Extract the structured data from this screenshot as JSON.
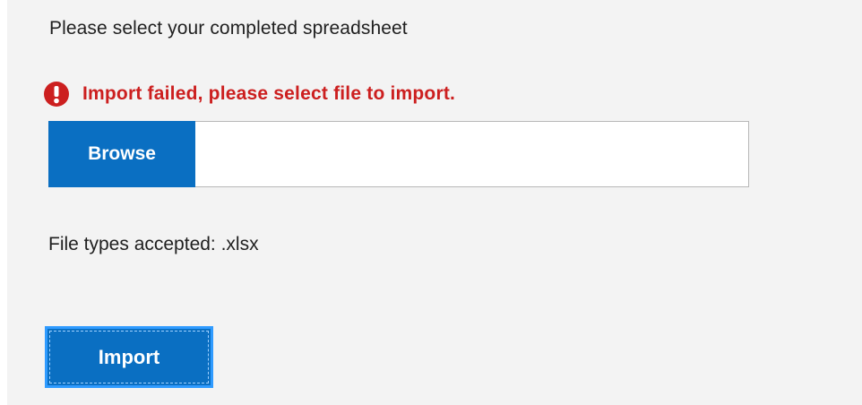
{
  "form": {
    "instruction": "Please select your completed spreadsheet",
    "error": {
      "icon": "error-exclamation-icon",
      "message": "Import failed, please select file to import.",
      "color": "#cc1f1f"
    },
    "file_picker": {
      "browse_label": "Browse",
      "file_name_value": "",
      "accent_color": "#0a6fc2"
    },
    "file_types_text": "File types accepted: .xlsx",
    "import_label": "Import"
  }
}
